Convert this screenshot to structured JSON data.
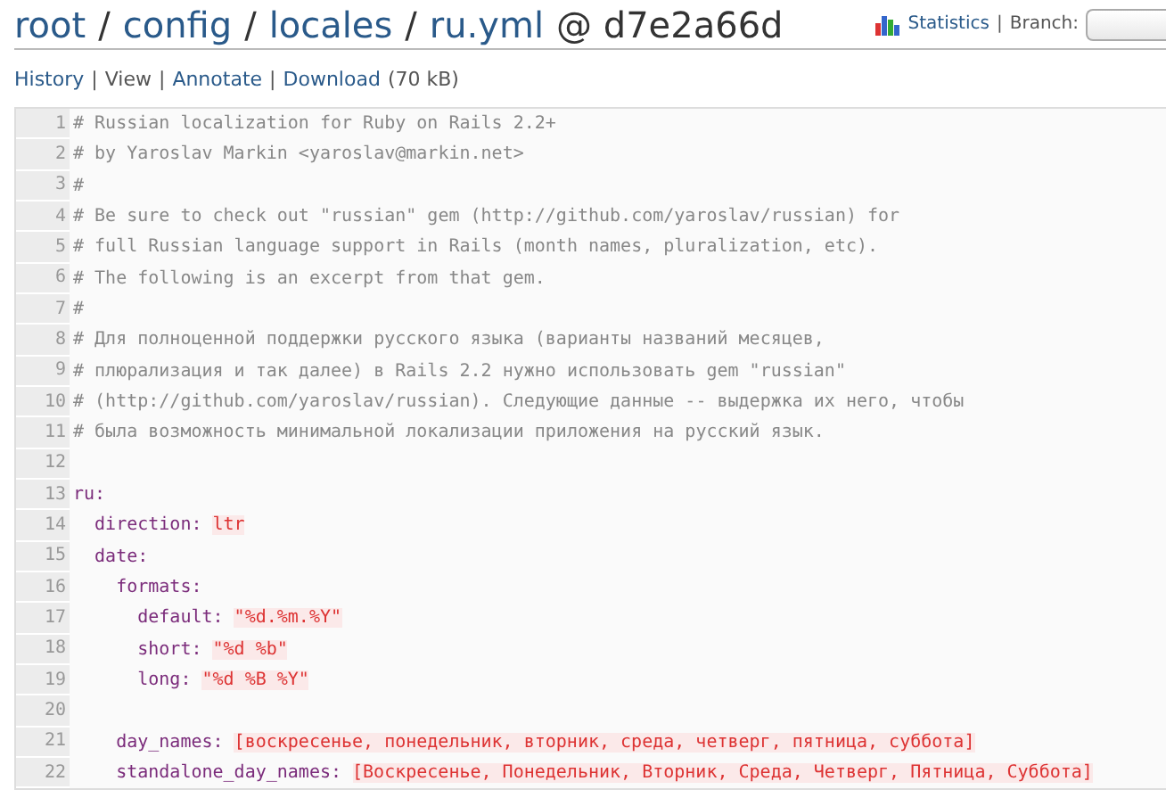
{
  "breadcrumb": [
    {
      "text": "root",
      "kind": "link"
    },
    {
      "text": "/",
      "kind": "sep"
    },
    {
      "text": "config",
      "kind": "link"
    },
    {
      "text": "/",
      "kind": "sep"
    },
    {
      "text": "locales",
      "kind": "link"
    },
    {
      "text": "/",
      "kind": "sep"
    },
    {
      "text": "ru.yml",
      "kind": "link"
    },
    {
      "text": "@ d7e2a66d",
      "kind": "plain"
    }
  ],
  "toolbar": {
    "statistics": "Statistics",
    "separator": "|",
    "branch_label": "Branch:"
  },
  "actions": [
    {
      "text": "History",
      "kind": "link"
    },
    {
      "text": "|",
      "kind": "sep"
    },
    {
      "text": "View",
      "kind": "plain"
    },
    {
      "text": "|",
      "kind": "sep"
    },
    {
      "text": "Annotate",
      "kind": "link"
    },
    {
      "text": "|",
      "kind": "sep"
    },
    {
      "text": "Download",
      "kind": "link"
    },
    {
      "text": "(70 kB)",
      "kind": "plain"
    }
  ],
  "code_lines": [
    {
      "number": "1",
      "segments": [
        {
          "kind": "comment",
          "text": "# Russian localization for Ruby on Rails 2.2+"
        }
      ]
    },
    {
      "number": "2",
      "segments": [
        {
          "kind": "comment",
          "text": "# by Yaroslav Markin <yaroslav@markin.net>"
        }
      ]
    },
    {
      "number": "3",
      "segments": [
        {
          "kind": "comment",
          "text": "#"
        }
      ]
    },
    {
      "number": "4",
      "segments": [
        {
          "kind": "comment",
          "text": "# Be sure to check out \"russian\" gem (http://github.com/yaroslav/russian) for"
        }
      ]
    },
    {
      "number": "5",
      "segments": [
        {
          "kind": "comment",
          "text": "# full Russian language support in Rails (month names, pluralization, etc)."
        }
      ]
    },
    {
      "number": "6",
      "segments": [
        {
          "kind": "comment",
          "text": "# The following is an excerpt from that gem."
        }
      ]
    },
    {
      "number": "7",
      "segments": [
        {
          "kind": "comment",
          "text": "#"
        }
      ]
    },
    {
      "number": "8",
      "segments": [
        {
          "kind": "comment",
          "text": "# Для полноценной поддержки русского языка (варианты названий месяцев,"
        }
      ]
    },
    {
      "number": "9",
      "segments": [
        {
          "kind": "comment",
          "text": "# плюрализация и так далее) в Rails 2.2 нужно использовать gem \"russian\""
        }
      ]
    },
    {
      "number": "10",
      "segments": [
        {
          "kind": "comment",
          "text": "# (http://github.com/yaroslav/russian). Следующие данные -- выдержка их него, чтобы"
        }
      ]
    },
    {
      "number": "11",
      "segments": [
        {
          "kind": "comment",
          "text": "# была возможность минимальной локализации приложения на русский язык."
        }
      ]
    },
    {
      "number": "12"
    },
    {
      "number": "13",
      "segments": [
        {
          "kind": "key",
          "text": "ru:"
        }
      ]
    },
    {
      "number": "14",
      "segments": [
        {
          "kind": "key",
          "text": "  direction:"
        },
        {
          "kind": "string",
          "text": "ltr"
        }
      ]
    },
    {
      "number": "15",
      "segments": [
        {
          "kind": "key",
          "text": "  date:"
        }
      ]
    },
    {
      "number": "16",
      "segments": [
        {
          "kind": "key",
          "text": "    formats:"
        }
      ]
    },
    {
      "number": "17",
      "segments": [
        {
          "kind": "key",
          "text": "      default:"
        },
        {
          "kind": "string",
          "text": "\"%d.%m.%Y\""
        }
      ]
    },
    {
      "number": "18",
      "segments": [
        {
          "kind": "key",
          "text": "      short:"
        },
        {
          "kind": "string",
          "text": "\"%d %b\""
        }
      ]
    },
    {
      "number": "19",
      "segments": [
        {
          "kind": "key",
          "text": "      long:"
        },
        {
          "kind": "string",
          "text": "\"%d %B %Y\""
        }
      ]
    },
    {
      "number": "20"
    },
    {
      "number": "21",
      "segments": [
        {
          "kind": "key",
          "text": "    day_names:"
        },
        {
          "kind": "string",
          "text": "[воскресенье, понедельник, вторник, среда, четверг, пятница, суббота]"
        }
      ]
    },
    {
      "number": "22",
      "segments": [
        {
          "kind": "key",
          "text": "    standalone_day_names:"
        },
        {
          "kind": "string",
          "text": "[Воскресенье, Понедельник, Вторник, Среда, Четверг, Пятница, Суббота]"
        }
      ]
    }
  ]
}
